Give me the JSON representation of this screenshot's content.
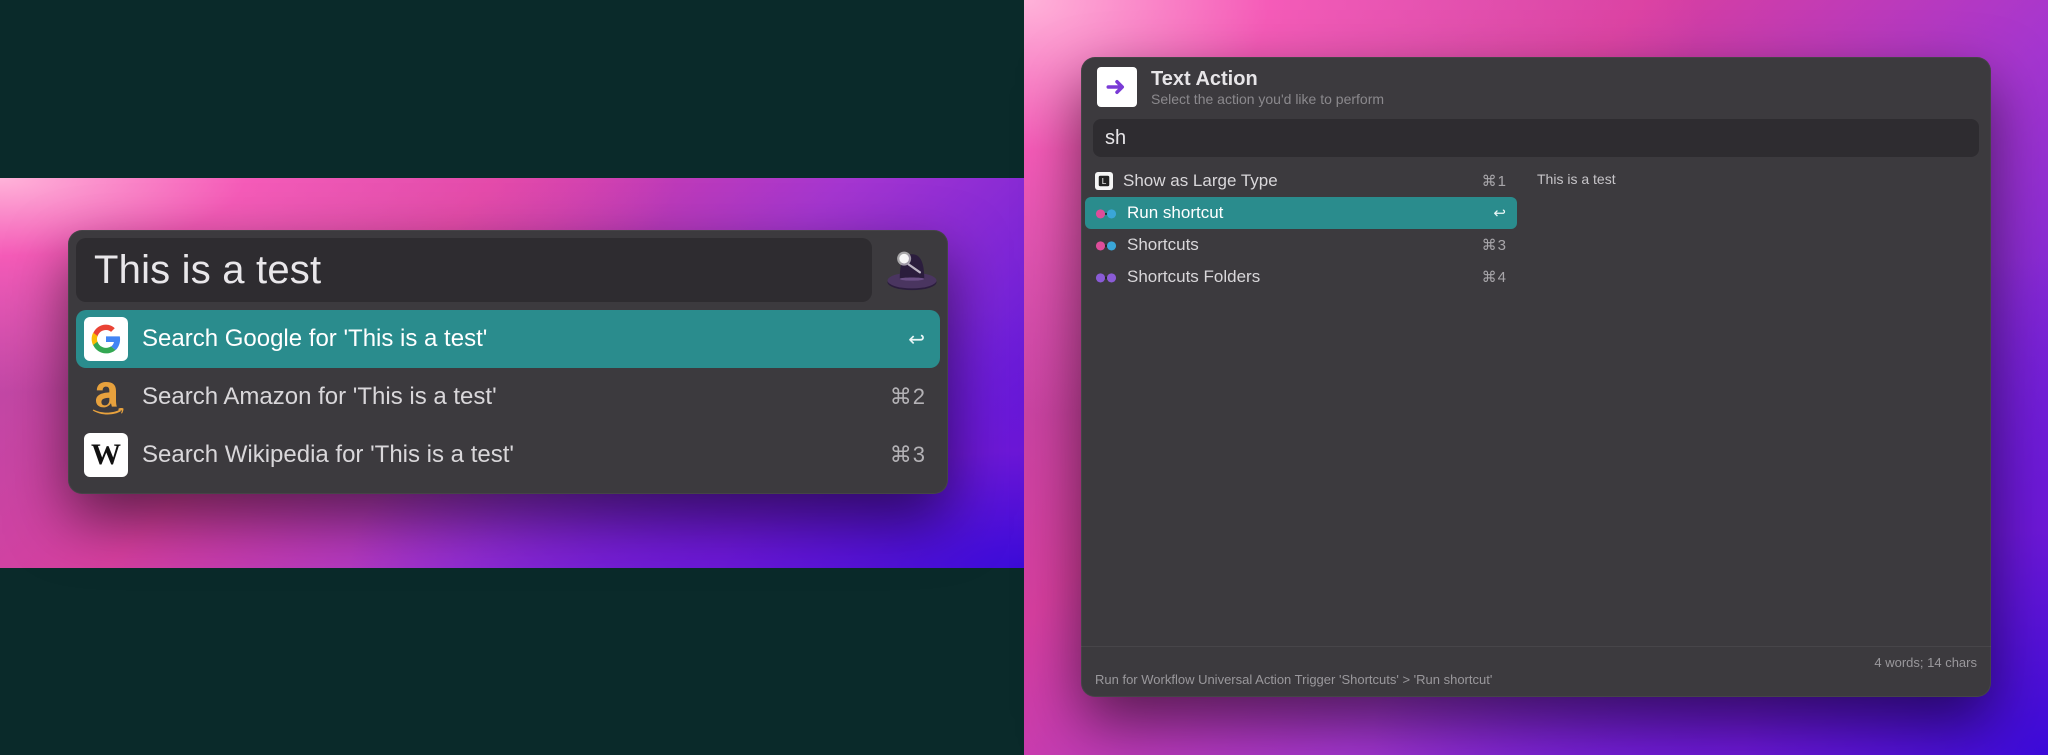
{
  "left": {
    "query": "This is a test",
    "results": [
      {
        "icon": "google",
        "label": "Search Google for 'This is a test'",
        "shortcut": "↩",
        "selected": true
      },
      {
        "icon": "amazon",
        "label": "Search Amazon for 'This is a test'",
        "shortcut": "⌘2",
        "selected": false
      },
      {
        "icon": "wikipedia",
        "label": "Search Wikipedia for 'This is a test'",
        "shortcut": "⌘3",
        "selected": false
      }
    ]
  },
  "right": {
    "title": "Text Action",
    "subtitle": "Select the action you'd like to perform",
    "query": "sh",
    "items": [
      {
        "icon": "large-type",
        "label": "Show as Large Type",
        "shortcut": "⌘1",
        "selected": false
      },
      {
        "icon": "glasses",
        "label": "Run shortcut",
        "shortcut": "↩",
        "selected": true
      },
      {
        "icon": "glasses",
        "label": "Shortcuts",
        "shortcut": "⌘3",
        "selected": false
      },
      {
        "icon": "glasses",
        "label": "Shortcuts Folders",
        "shortcut": "⌘4",
        "selected": false
      }
    ],
    "preview": "This is a test",
    "stats": "4 words; 14 chars",
    "description": "Run for Workflow Universal Action Trigger 'Shortcuts' > 'Run shortcut'"
  }
}
